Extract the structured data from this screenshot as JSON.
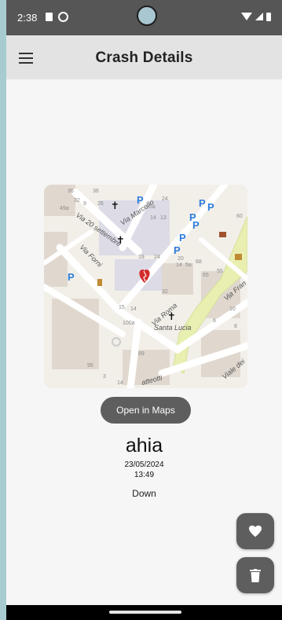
{
  "status_bar": {
    "time": "2:38"
  },
  "app_bar": {
    "title": "Crash Details"
  },
  "map": {
    "streets": [
      "Via 20 settembre",
      "Via Marcello",
      "Via Forni",
      "Via Roma",
      "Santa Lucia",
      "Via Fran",
      "Viale dei",
      "atteotti"
    ],
    "house_numbers": [
      "36",
      "32",
      "36",
      "49a",
      "9",
      "26",
      "15a",
      "24",
      "14",
      "13",
      "60",
      "19",
      "24",
      "20",
      "14",
      "5a",
      "68",
      "65",
      "55",
      "32",
      "15",
      "14",
      "100a",
      "89",
      "95",
      "3",
      "14",
      "6",
      "17",
      "10",
      "8"
    ]
  },
  "open_in_maps_label": "Open in Maps",
  "crash": {
    "name": "ahia",
    "date": "23/05/2024",
    "time": "13:49",
    "direction": "Down"
  },
  "icons": {
    "menu": "menu-icon",
    "favorite": "heart-icon",
    "delete": "trash-icon"
  },
  "colors": {
    "status_bar": "#565656",
    "app_bar": "#e3e3e3",
    "background": "#f6f6f6",
    "button": "#5e5e5e",
    "map_marker": "#d42a2a"
  }
}
